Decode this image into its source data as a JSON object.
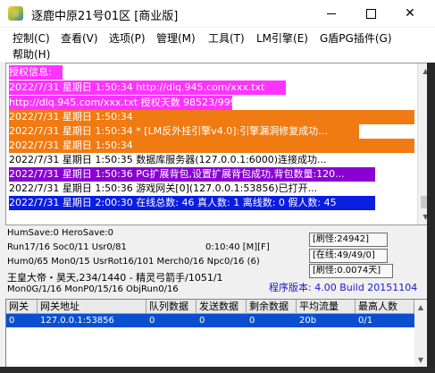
{
  "window": {
    "title": "逐鹿中原21号01区 [商业版]",
    "icons": {
      "app": "app-logo-icon",
      "minimize": "minimize-icon",
      "maximize": "maximize-icon",
      "close": "close-icon"
    },
    "close_glyph": "✕"
  },
  "menu": [
    {
      "label": "控制(C)"
    },
    {
      "label": "查看(V)"
    },
    {
      "label": "选项(P)"
    },
    {
      "label": "管理(M)"
    },
    {
      "label": "工具(T)"
    },
    {
      "label": "LM引擎(E)"
    },
    {
      "label": "G盾PG插件(G)"
    },
    {
      "label": "帮助(H)"
    }
  ],
  "log": [
    {
      "text": "授权信息:",
      "bg": "#ff33ff",
      "fg": "#ffffff"
    },
    {
      "text": "2022/7/31 星期日 1:50:34 http://dlq.945.com/xxx.txt",
      "bg": "#ff33ff",
      "fg": "#ffffff"
    },
    {
      "text": "http://dlq.945.com/xxx.txt 授权天数 98523/99999",
      "bg": "#ff33ff",
      "fg": "#ffffff"
    },
    {
      "text": "2022/7/31 星期日 1:50:34",
      "bg": "#f07b12",
      "fg": "#ffffff"
    },
    {
      "text": "2022/7/31 星期日 1:50:34 * [LM反外挂引擎v4.0]:引擎漏洞修复成功...",
      "bg": "#f07b12",
      "fg": "#ffffff"
    },
    {
      "text": "2022/7/31 星期日 1:50:34",
      "bg": "#f07b12",
      "fg": "#ffffff"
    },
    {
      "text": "2022/7/31 星期日 1:50:35 数据库服务器(127.0.0.1:6000)连接成功...",
      "bg": "#ffffff",
      "fg": "#000000"
    },
    {
      "text": "2022/7/31 星期日 1:50:36 PG扩展背包,设置扩展背包成功,背包数量:120...",
      "bg": "#8a00d4",
      "fg": "#ffffff"
    },
    {
      "text": "2022/7/31 星期日 1:50:36 游戏网关[0](127.0.0.1:53856)已打开...",
      "bg": "#ffffff",
      "fg": "#000000"
    },
    {
      "text": "2022/7/31 星期日 2:00:30 在线总数: 46 真人数: 1 离线数: 0 假人数: 45",
      "bg": "#0a1ee0",
      "fg": "#ffffff"
    }
  ],
  "status": {
    "line1": "HumSave:0 HeroSave:0",
    "line2a": "Run17/16 Soc0/11 Usr0/81",
    "line2b": "0:10:40 [M][F]",
    "line3": "Hum0/65 Mon0/15 UsrRot16/101 Merch0/16 Npc0/16 (6)",
    "line4": "王皇大帝・昊天,234/1440 - 精灵弓箭手/1051/1",
    "line5": "Mon0G/1/16 MonP0/15/16 ObjRun0/16",
    "refresh": "[刷怪:24942]",
    "online": "[在线:49/49/0]",
    "spawn": "[刷怪:0.0074天]",
    "version": "程序版本: 4.00 Build 20151104"
  },
  "table": {
    "headers": [
      "网关",
      "网关地址",
      "队列数据",
      "发送数据",
      "剩余数据",
      "平均流量",
      "最高人数"
    ],
    "rows": [
      [
        "0",
        "127.0.0.1:53856",
        "0",
        "0",
        "0",
        "20b",
        "0/1"
      ]
    ]
  }
}
